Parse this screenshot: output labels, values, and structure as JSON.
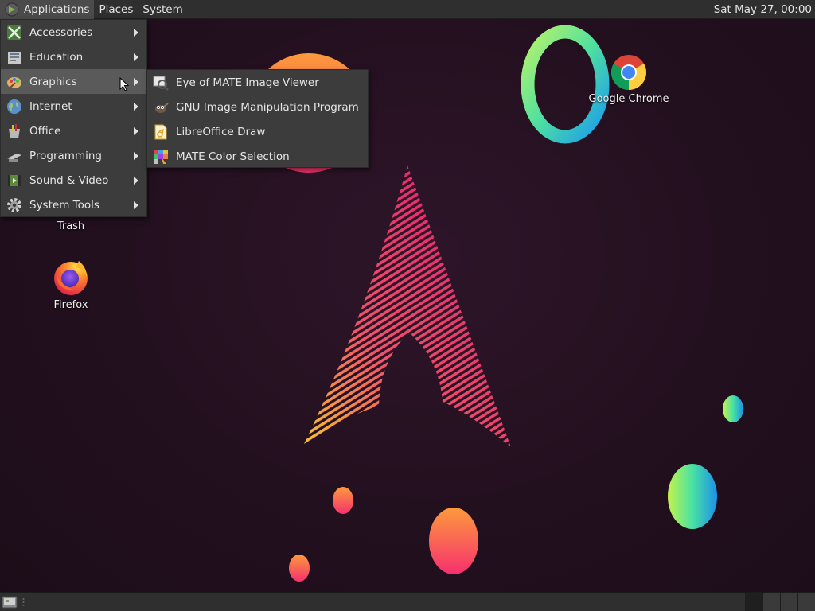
{
  "top_panel": {
    "menus": [
      {
        "label": "Applications"
      },
      {
        "label": "Places"
      },
      {
        "label": "System"
      }
    ],
    "clock": "Sat May 27, 00:00"
  },
  "desktop": {
    "icons": [
      {
        "label": "Trash",
        "icon": "trash-icon"
      },
      {
        "label": "Firefox",
        "icon": "firefox-icon"
      },
      {
        "label": "Google Chrome",
        "icon": "chrome-icon"
      }
    ]
  },
  "applications_menu": {
    "items": [
      {
        "label": "Accessories",
        "icon": "accessories-icon"
      },
      {
        "label": "Education",
        "icon": "education-icon"
      },
      {
        "label": "Graphics",
        "icon": "graphics-icon",
        "highlighted": true
      },
      {
        "label": "Internet",
        "icon": "globe-icon"
      },
      {
        "label": "Office",
        "icon": "office-icon"
      },
      {
        "label": "Programming",
        "icon": "programming-icon"
      },
      {
        "label": "Sound & Video",
        "icon": "multimedia-icon"
      },
      {
        "label": "System Tools",
        "icon": "gear-icon"
      }
    ]
  },
  "graphics_submenu": {
    "items": [
      {
        "label": "Eye of MATE Image Viewer",
        "icon": "image-viewer-icon"
      },
      {
        "label": "GNU Image Manipulation Program",
        "icon": "gimp-icon"
      },
      {
        "label": "LibreOffice Draw",
        "icon": "libreoffice-draw-icon"
      },
      {
        "label": "MATE Color Selection",
        "icon": "color-selection-icon"
      }
    ]
  },
  "colors": {
    "panel": "#2f2f2f",
    "menu": "#3c3c3c",
    "menu_highlight": "#5a5a5a",
    "wallpaper": "#24101f",
    "arch_pink": "#e8206e",
    "arch_yellow": "#f7c531"
  }
}
